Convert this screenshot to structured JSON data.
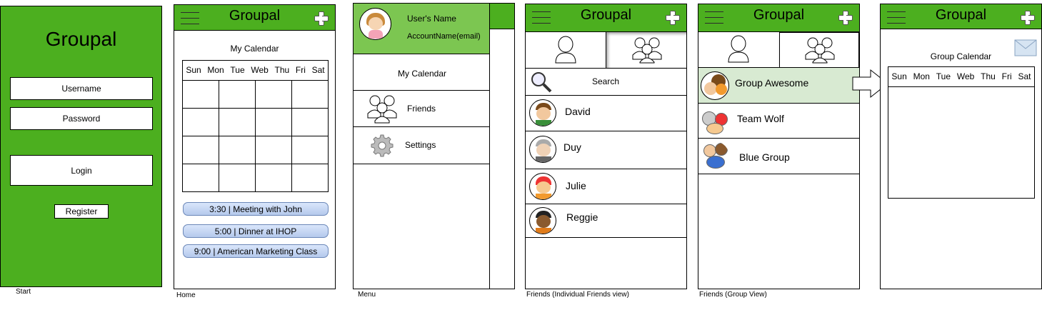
{
  "app_title": "Groupal",
  "colors": {
    "brand_green": "#4caf1f",
    "menu_header": "#7cc651",
    "selected_row": "#d8ead2",
    "pill": "#c7d8f5"
  },
  "start": {
    "title": "Groupal",
    "username_placeholder": "Username",
    "password_placeholder": "Password",
    "login_label": "Login",
    "register_label": "Register",
    "caption": "Start"
  },
  "home": {
    "title": "Groupal",
    "calendar_title": "My Calendar",
    "weekdays": [
      "Sun",
      "Mon",
      "Tue",
      "Web",
      "Thu",
      "Fri",
      "Sat"
    ],
    "events": [
      "3:30 | Meeting with John",
      "5:00 | Dinner at IHOP",
      "9:00 | American Marketing Class"
    ],
    "caption": "Home"
  },
  "menu": {
    "user_name": "User's Name",
    "account_name": "AccountName(email)",
    "items": [
      {
        "label": "My Calendar",
        "icon": "none"
      },
      {
        "label": "Friends",
        "icon": "group-icon"
      },
      {
        "label": "Settings",
        "icon": "gear-icon"
      }
    ],
    "caption": "Menu"
  },
  "friends": {
    "title": "Groupal",
    "search_label": "Search",
    "people": [
      "David",
      "Duy",
      "Julie",
      "Reggie"
    ],
    "caption": "Friends (Individual Friends view)"
  },
  "groups": {
    "title": "Groupal",
    "items": [
      "Group Awesome",
      "Team Wolf",
      "Blue Group"
    ],
    "caption": "Friends (Group View)"
  },
  "group_calendar": {
    "title": "Groupal",
    "calendar_title": "Group Calendar",
    "weekdays": [
      "Sun",
      "Mon",
      "Tue",
      "Web",
      "Thu",
      "Fri",
      "Sat"
    ]
  }
}
